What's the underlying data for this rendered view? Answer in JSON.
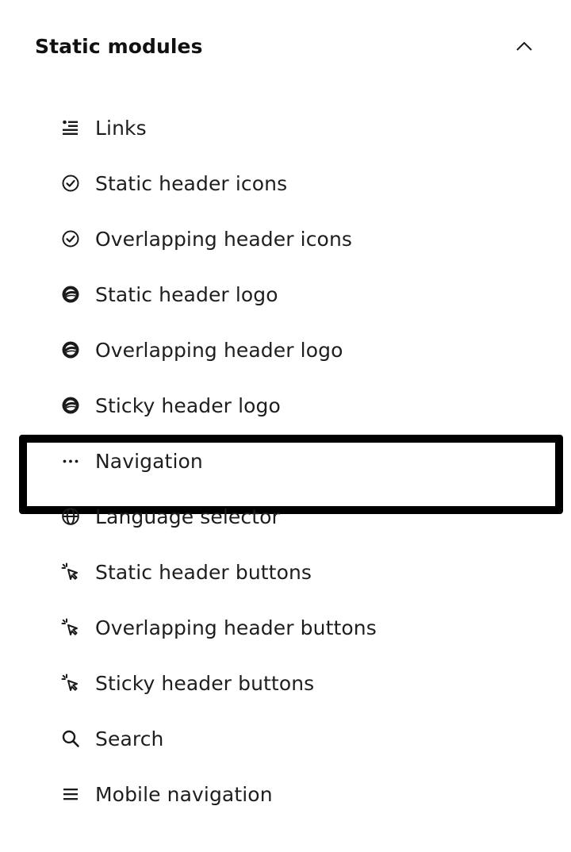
{
  "section": {
    "title": "Static modules",
    "toggle_icon": "chevron-up-icon",
    "expanded": true
  },
  "items": [
    {
      "label": "Links",
      "icon": "list-links-icon"
    },
    {
      "label": "Static header icons",
      "icon": "check-circle-icon"
    },
    {
      "label": "Overlapping header icons",
      "icon": "check-circle-icon"
    },
    {
      "label": "Static header logo",
      "icon": "logo-badge-icon"
    },
    {
      "label": "Overlapping header logo",
      "icon": "logo-badge-icon"
    },
    {
      "label": "Sticky header logo",
      "icon": "logo-badge-icon"
    },
    {
      "label": "Navigation",
      "icon": "ellipsis-icon",
      "focused": true
    },
    {
      "label": "Language selector",
      "icon": "globe-icon"
    },
    {
      "label": "Static header buttons",
      "icon": "cursor-click-icon"
    },
    {
      "label": "Overlapping header buttons",
      "icon": "cursor-click-icon"
    },
    {
      "label": "Sticky header buttons",
      "icon": "cursor-click-icon"
    },
    {
      "label": "Search",
      "icon": "search-icon"
    },
    {
      "label": "Mobile navigation",
      "icon": "hamburger-icon"
    }
  ],
  "colors": {
    "text": "#1e1e1e",
    "focus_outline": "#000000",
    "background": "#ffffff"
  }
}
